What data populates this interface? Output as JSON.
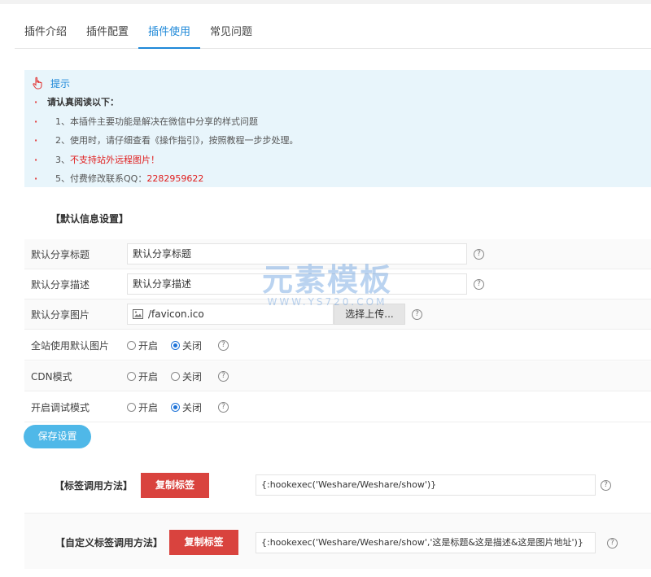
{
  "tabs": [
    {
      "label": "插件介绍",
      "active": false
    },
    {
      "label": "插件配置",
      "active": false
    },
    {
      "label": "插件使用",
      "active": true
    },
    {
      "label": "常见问题",
      "active": false
    }
  ],
  "tip": {
    "title": "提示",
    "heading": "请认真阅读以下：",
    "items": [
      "1、本插件主要功能是解决在微信中分享的样式问题",
      "2、使用时，请仔细查看《操作指引》，按照教程一步步处理。",
      "3、",
      "5、付费修改联系QQ："
    ],
    "item3_highlight": "不支持站外远程图片！",
    "qq": "2282959622"
  },
  "section_title": "【默认信息设置】",
  "fields": {
    "share_title": {
      "label": "默认分享标题",
      "value": "默认分享标题"
    },
    "share_desc": {
      "label": "默认分享描述",
      "value": "默认分享描述"
    },
    "share_image": {
      "label": "默认分享图片",
      "value": "/favicon.ico",
      "upload_label": "选择上传..."
    },
    "site_default_image": {
      "label": "全站使用默认图片",
      "on": "开启",
      "off": "关闭",
      "selected": "off"
    },
    "cdn_mode": {
      "label": "CDN模式",
      "on": "开启",
      "off": "关闭",
      "selected": "none"
    },
    "debug_mode": {
      "label": "开启调试模式",
      "on": "开启",
      "off": "关闭",
      "selected": "off"
    }
  },
  "help_glyph": "?",
  "save_label": "保存设置",
  "tag_call": {
    "label": "【标签调用方法】",
    "copy_label": "复制标签",
    "code": "{:hookexec('Weshare/Weshare/show')}"
  },
  "custom_tag_call": {
    "label": "【自定义标签调用方法】",
    "copy_label": "复制标签",
    "code": "{:hookexec('Weshare/Weshare/show','这是标题&这是描述&这是图片地址')}"
  },
  "watermark": {
    "main": "元素模板",
    "sub": "WWW.YS720.COM"
  },
  "colors": {
    "accent": "#1e88d8",
    "tip_bg": "#e8f5fb",
    "save_btn": "#4fb8e8",
    "copy_btn": "#d9433e",
    "alert_red": "#e02020"
  }
}
